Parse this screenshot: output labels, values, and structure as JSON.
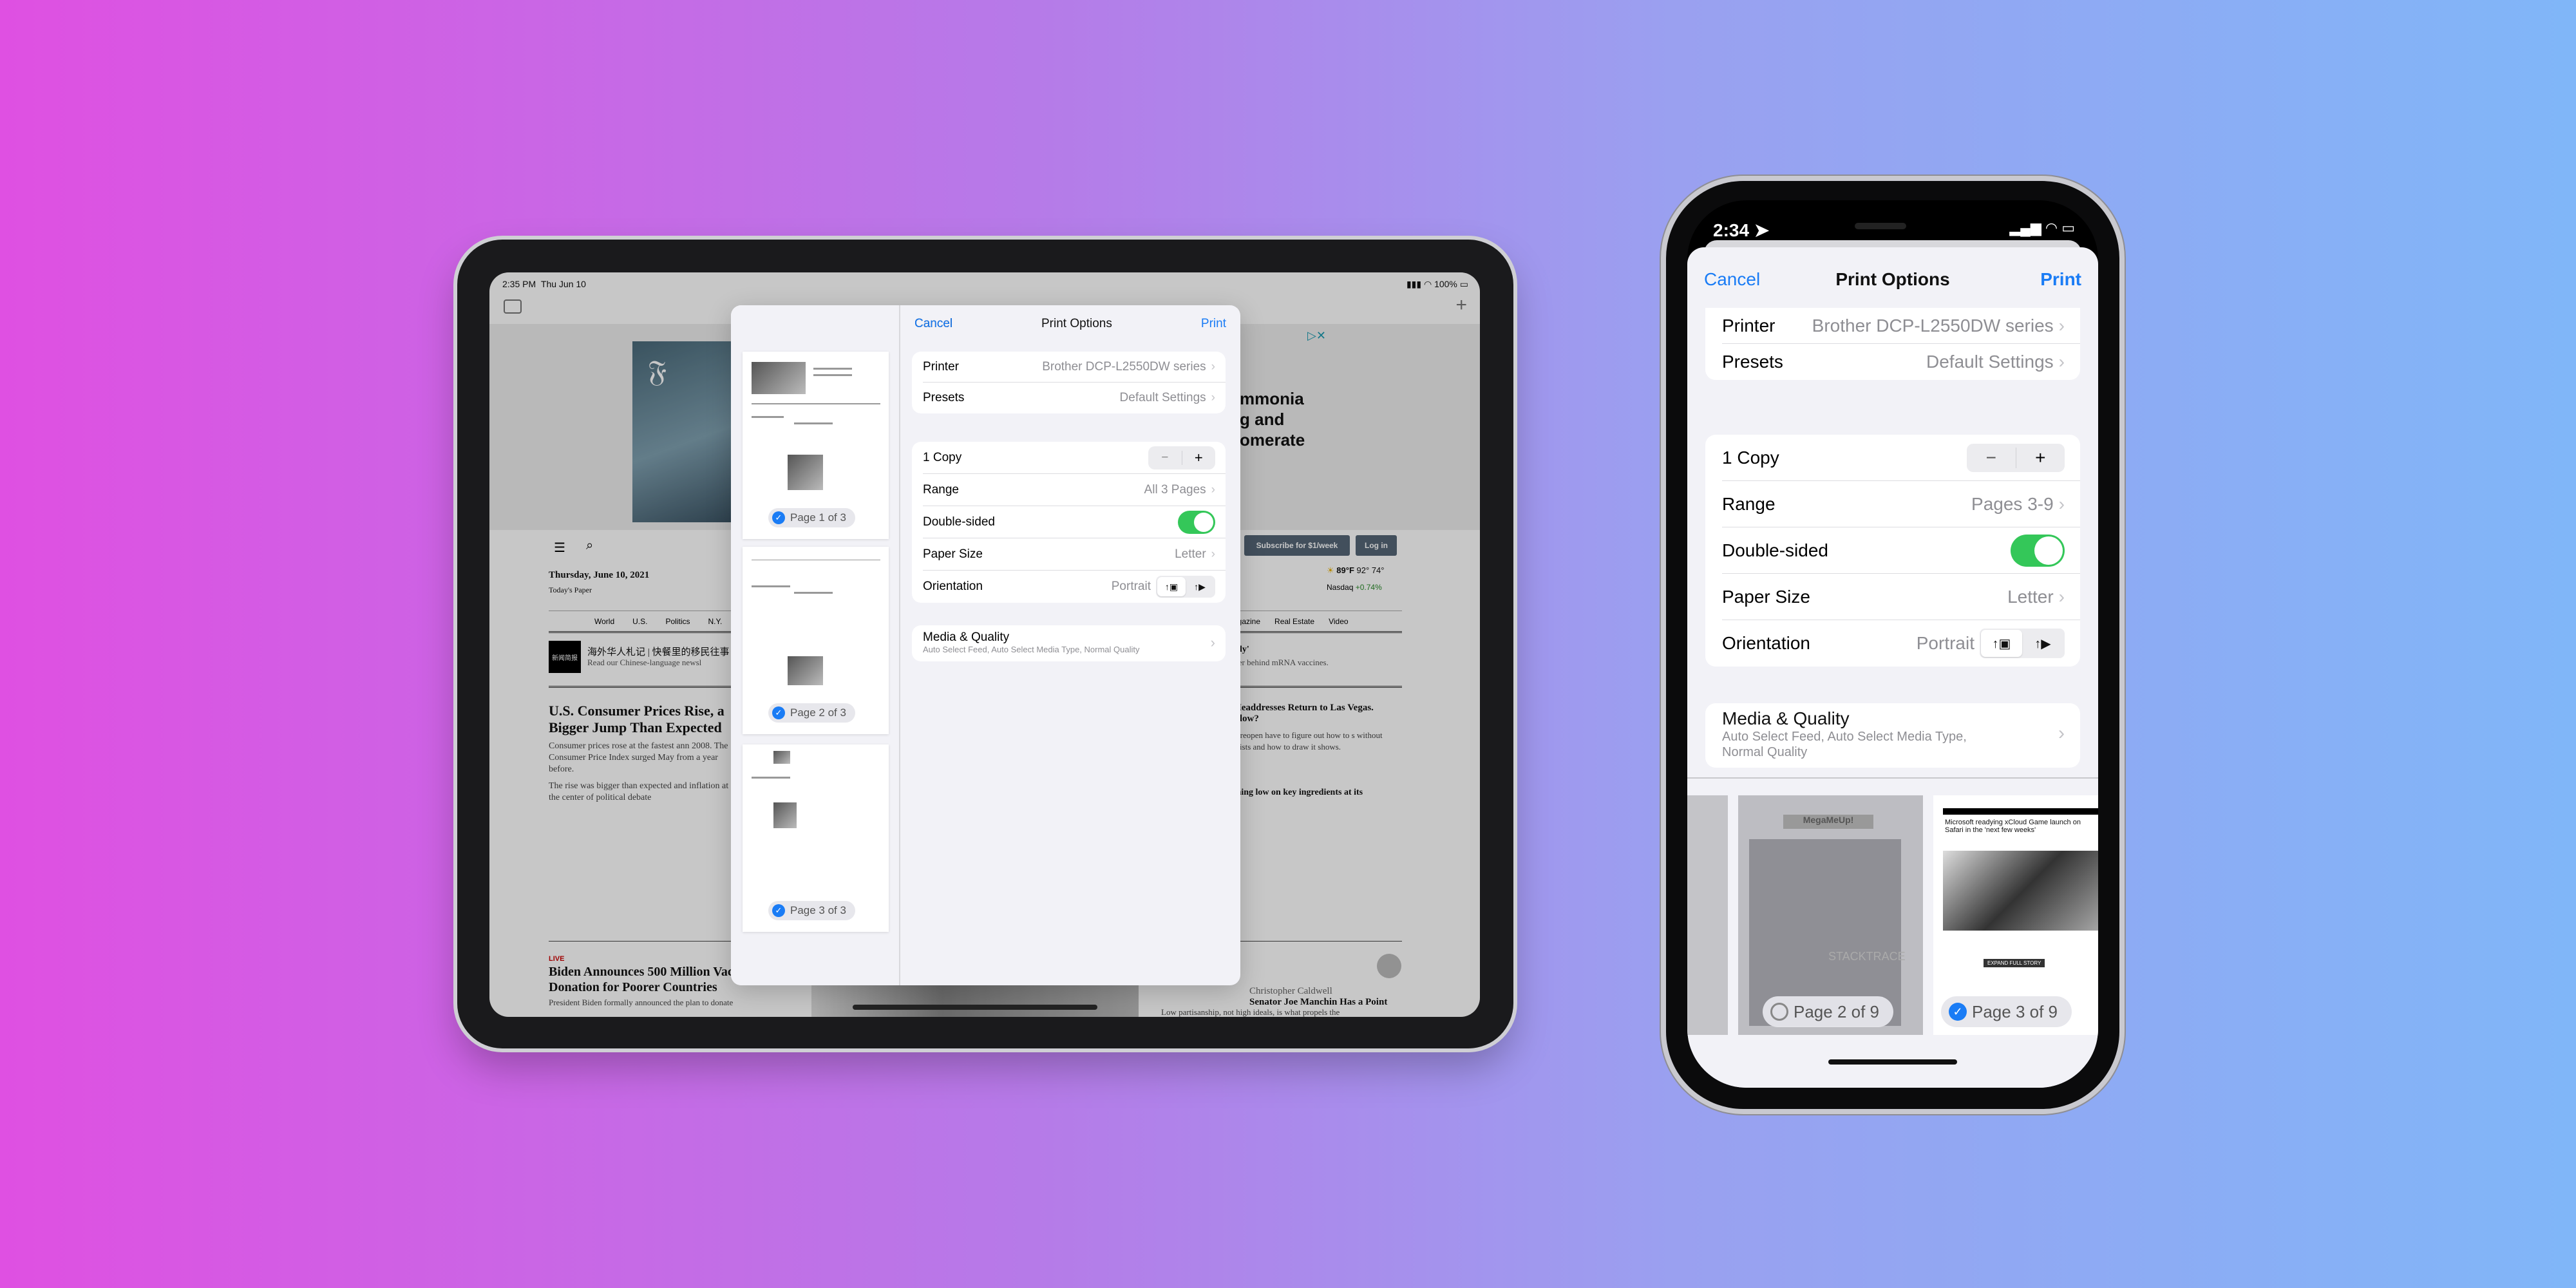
{
  "ipad": {
    "status": {
      "time": "2:35 PM",
      "date": "Thu Jun 10",
      "battery": "100%"
    },
    "news": {
      "ad_text": [
        "mmonia",
        "g and",
        "omerate"
      ],
      "subscribe_button": "Subscribe for $1/week",
      "login_button": "Log in",
      "date": "Thursday, June 10, 2021",
      "todays_paper": "Today's Paper",
      "weather": {
        "temp": "89°F",
        "hi": "92°",
        "lo": "74°"
      },
      "market": {
        "name": "Nasdaq",
        "change": "+0.74%"
      },
      "sections": [
        "World",
        "U.S.",
        "Politics",
        "N.Y."
      ],
      "sections_right": [
        "Magazine",
        "Real Estate",
        "Video"
      ],
      "chinese_logo": "新闻简报",
      "chinese_title": "海外华人札记 | 快餐里的移民往事",
      "chinese_sub": "Read our Chinese-language newsl",
      "daily_title": "Daily'",
      "daily_sub": "oneer behind mRNA vaccines.",
      "headline": "U.S. Consumer Prices Rise, a Bigger Jump Than Expected",
      "bullets": [
        "Consumer prices rose at the fastest ann 2008. The Consumer Price Index surged May from a year before.",
        "The rise was bigger than expected and inflation at the center of political debate"
      ],
      "right_headline": "d Headdresses Return to Las Vegas. Follow?",
      "right_text": "s to reopen have to figure out how to s without tourists and how to draw it shows.",
      "right_headline2": "unning low on key ingredients at its",
      "live_label": "LIVE",
      "biden_headline": "Biden Announces 500 Million Vaccine Donation for Poorer Countries",
      "biden_sub": "President Biden formally announced the plan to donate",
      "opinion_author": "Christopher Caldwell",
      "opinion_headline": "Senator Joe Manchin Has a Point",
      "opinion_sub": "Low partisanship, not high ideals, is what propels the"
    },
    "print": {
      "cancel": "Cancel",
      "title": "Print Options",
      "print": "Print",
      "printer_label": "Printer",
      "printer_value": "Brother DCP-L2550DW series",
      "presets_label": "Presets",
      "presets_value": "Default Settings",
      "copies_label": "1 Copy",
      "range_label": "Range",
      "range_value": "All 3 Pages",
      "double_sided_label": "Double-sided",
      "double_sided_on": true,
      "paper_label": "Paper Size",
      "paper_value": "Letter",
      "orientation_label": "Orientation",
      "orientation_value": "Portrait",
      "media_label": "Media & Quality",
      "media_sub": "Auto Select Feed, Auto Select Media Type, Normal Quality",
      "pages": [
        {
          "label": "Page 1 of 3",
          "selected": true
        },
        {
          "label": "Page 2 of 3",
          "selected": true
        },
        {
          "label": "Page 3 of 3",
          "selected": true
        }
      ]
    }
  },
  "iphone": {
    "status": {
      "time": "2:34"
    },
    "print": {
      "cancel": "Cancel",
      "title": "Print Options",
      "print": "Print",
      "printer_label": "Printer",
      "printer_value": "Brother DCP-L2550DW series",
      "presets_label": "Presets",
      "presets_value": "Default Settings",
      "copies_label": "1 Copy",
      "range_label": "Range",
      "range_value": "Pages 3-9",
      "double_sided_label": "Double-sided",
      "double_sided_on": true,
      "paper_label": "Paper Size",
      "paper_value": "Letter",
      "orientation_label": "Orientation",
      "orientation_value": "Portrait",
      "media_label": "Media & Quality",
      "media_sub": "Auto Select Feed, Auto Select Media Type, Normal Quality",
      "pages": [
        {
          "label": "Page 2 of 9",
          "selected": false
        },
        {
          "label": "Page 3 of 9",
          "selected": true
        }
      ],
      "page3_headline": "Microsoft readying xCloud Game launch on Safari in the 'next few weeks'",
      "page3_button": "EXPAND FULL STORY",
      "page2_banner": "MegaMeUp!",
      "page2_brand": "STACKTRACE"
    }
  },
  "colors": {
    "accent": "#1a7cf5",
    "toggle_on": "#34c759",
    "bg_left": "#df50e2",
    "bg_right": "#80b6f8"
  }
}
